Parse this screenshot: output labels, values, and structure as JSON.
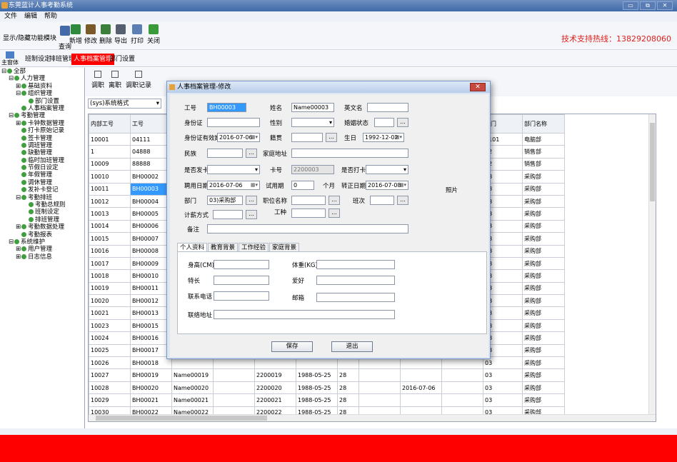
{
  "window": {
    "title": "东莞蓝计人事考勤系统",
    "min_label": "▭",
    "max_label": "⧉",
    "close_label": "✕"
  },
  "menu": [
    "文件",
    "编辑",
    "帮助"
  ],
  "toolbar": {
    "toggle_label": "显示/隐藏功能模块",
    "buttons": [
      {
        "label": "查询",
        "icon": "search-icon",
        "color": "#4469a8"
      },
      {
        "label": "新增",
        "icon": "add-icon",
        "color": "#2f8a3d"
      },
      {
        "label": "修改",
        "icon": "edit-icon",
        "color": "#7a5a2a"
      },
      {
        "label": "删除",
        "icon": "delete-icon",
        "color": "#3b7f3b"
      },
      {
        "label": "导出",
        "icon": "export-icon",
        "color": "#555f6e"
      },
      {
        "label": "打印",
        "icon": "print-icon",
        "color": "#5a7fb5"
      },
      {
        "label": "关闭",
        "icon": "close-icon",
        "color": "#3a9a3a"
      }
    ],
    "hotline": "技术支持热线：13829208060"
  },
  "tabs": {
    "home_label": "主窗体",
    "items": [
      "班制设定",
      "排班管理",
      "人事档案管理",
      "部门设置"
    ],
    "active_index": 2
  },
  "tree": [
    {
      "label": "全部",
      "level": 0,
      "exp": "⊟"
    },
    {
      "label": "人力管理",
      "level": 1,
      "exp": "⊟"
    },
    {
      "label": "基础资料",
      "level": 2,
      "exp": "⊞"
    },
    {
      "label": "组织管理",
      "level": 2,
      "exp": "⊟"
    },
    {
      "label": "部门设置",
      "level": 3,
      "exp": ""
    },
    {
      "label": "人事档案管理",
      "level": 2,
      "exp": ""
    },
    {
      "label": "考勤管理",
      "level": 1,
      "exp": "⊟"
    },
    {
      "label": "卡钟数据管理",
      "level": 2,
      "exp": "⊞"
    },
    {
      "label": "打卡原始记录",
      "level": 2,
      "exp": ""
    },
    {
      "label": "签卡管理",
      "level": 2,
      "exp": ""
    },
    {
      "label": "调班管理",
      "level": 2,
      "exp": ""
    },
    {
      "label": "缺勤管理",
      "level": 2,
      "exp": ""
    },
    {
      "label": "临时加班管理",
      "level": 2,
      "exp": ""
    },
    {
      "label": "节假日设定",
      "level": 2,
      "exp": ""
    },
    {
      "label": "年假管理",
      "level": 2,
      "exp": ""
    },
    {
      "label": "调休管理",
      "level": 2,
      "exp": ""
    },
    {
      "label": "发补卡登记",
      "level": 2,
      "exp": ""
    },
    {
      "label": "考勤排班",
      "level": 2,
      "exp": "⊟"
    },
    {
      "label": "考勤总规则",
      "level": 3,
      "exp": ""
    },
    {
      "label": "班制设定",
      "level": 3,
      "exp": ""
    },
    {
      "label": "排班管理",
      "level": 3,
      "exp": ""
    },
    {
      "label": "考勤数据处理",
      "level": 2,
      "exp": "⊞"
    },
    {
      "label": "考勤报表",
      "level": 2,
      "exp": ""
    },
    {
      "label": "系统维护",
      "level": 1,
      "exp": "⊟"
    },
    {
      "label": "用户管理",
      "level": 2,
      "exp": "⊞"
    },
    {
      "label": "日志信息",
      "level": 2,
      "exp": "⊞"
    }
  ],
  "subtools": [
    {
      "label": "调职"
    },
    {
      "label": "离职"
    },
    {
      "label": "调职记录"
    }
  ],
  "format_combo": "(sys)系统格式",
  "grid": {
    "headers": [
      "内部工号",
      "工号",
      "姓名",
      "",
      "卡号",
      "生日",
      "",
      "",
      "身份证有效期结束日期",
      "籍贯",
      "部门",
      "部门名称"
    ],
    "rows": [
      [
        "10001",
        "04111",
        "",
        "",
        "",
        "",
        "",
        "",
        "2028-08-16",
        "湖南",
        "0101",
        "电脑部"
      ],
      [
        "1",
        "04888",
        "",
        "",
        "",
        "",
        "",
        "",
        "2016-05-02",
        "",
        "02",
        "销售部"
      ],
      [
        "10009",
        "88888",
        "",
        "",
        "",
        "",
        "",
        "",
        "2016-06-25",
        "",
        "02",
        "销售部"
      ],
      [
        "10010",
        "BH00002",
        "",
        "",
        "",
        "",
        "",
        "",
        "2016-07-06",
        "",
        "03",
        "采购部"
      ],
      [
        "10011",
        "BH00003",
        "",
        "",
        "",
        "",
        "",
        "",
        "2016-07-06",
        "",
        "03",
        "采购部"
      ],
      [
        "10012",
        "BH00004",
        "",
        "",
        "",
        "",
        "",
        "",
        "2016-07-06",
        "",
        "03",
        "采购部"
      ],
      [
        "10013",
        "BH00005",
        "",
        "",
        "",
        "",
        "",
        "",
        "2016-07-06",
        "",
        "03",
        "采购部"
      ],
      [
        "10014",
        "BH00006",
        "",
        "",
        "",
        "",
        "",
        "",
        "2016-07-06",
        "",
        "03",
        "采购部"
      ],
      [
        "10015",
        "BH00007",
        "",
        "",
        "",
        "",
        "",
        "",
        "2016-07-06",
        "",
        "03",
        "采购部"
      ],
      [
        "10016",
        "BH00008",
        "",
        "",
        "",
        "",
        "",
        "",
        "2016-07-06",
        "",
        "03",
        "采购部"
      ],
      [
        "10017",
        "BH00009",
        "",
        "",
        "",
        "",
        "",
        "",
        "2016-07-06",
        "",
        "03",
        "采购部"
      ],
      [
        "10018",
        "BH00010",
        "",
        "",
        "",
        "",
        "",
        "",
        "2016-07-06",
        "",
        "03",
        "采购部"
      ],
      [
        "10019",
        "BH00011",
        "",
        "",
        "",
        "",
        "",
        "",
        "2016-07-06",
        "",
        "03",
        "采购部"
      ],
      [
        "10020",
        "BH00012",
        "",
        "",
        "",
        "",
        "",
        "",
        "",
        "",
        "03",
        "采购部"
      ],
      [
        "10021",
        "BH00013",
        "",
        "",
        "",
        "",
        "",
        "",
        "",
        "",
        "03",
        "采购部"
      ],
      [
        "10023",
        "BH00015",
        "",
        "",
        "",
        "",
        "",
        "",
        "",
        "",
        "03",
        "采购部"
      ],
      [
        "10024",
        "BH00016",
        "",
        "",
        "",
        "",
        "",
        "",
        "",
        "",
        "03",
        "采购部"
      ],
      [
        "10025",
        "BH00017",
        "",
        "",
        "",
        "",
        "",
        "",
        "",
        "",
        "03",
        "采购部"
      ],
      [
        "10026",
        "BH00018",
        "",
        "",
        "",
        "",
        "",
        "",
        "",
        "",
        "03",
        "采购部"
      ],
      [
        "10027",
        "BH00019",
        "Name00019",
        "",
        "2200019",
        "1988-05-25",
        "28",
        "",
        "",
        "",
        "03",
        "采购部"
      ],
      [
        "10028",
        "BH00020",
        "Name00020",
        "",
        "2200020",
        "1988-05-25",
        "28",
        "",
        "2016-07-06",
        "",
        "03",
        "采购部"
      ],
      [
        "10029",
        "BH00021",
        "Name00021",
        "",
        "2200021",
        "1988-05-25",
        "28",
        "",
        "",
        "",
        "03",
        "采购部"
      ],
      [
        "10030",
        "BH00022",
        "Name00022",
        "",
        "2200022",
        "1988-05-25",
        "28",
        "",
        "",
        "",
        "03",
        "采购部"
      ],
      [
        "10031",
        "BH00023",
        "Name00023",
        "",
        "2200023",
        "1988-05-25",
        "28",
        "",
        "",
        "",
        "03",
        "采购部"
      ]
    ],
    "selected_row": 4
  },
  "dialog": {
    "title": "人事档案管理-修改",
    "close_label": "✕",
    "labels": {
      "gonghao": "工号",
      "name": "姓名",
      "ename": "英文名",
      "idcard": "身份证",
      "gender": "性别",
      "marital": "婚姻状态",
      "idvalid": "身份证有效期",
      "native": "籍贯",
      "birthday": "生日",
      "nation": "民族",
      "address": "家庭地址",
      "isissue": "是否发卡",
      "cardno": "卡号",
      "isclock": "是否打卡",
      "photo": "照片",
      "hiredate": "聘用日期",
      "trial": "试用期",
      "month": "个月",
      "regular": "转正日期",
      "dept": "部门",
      "position": "职位名称",
      "shift": "班次",
      "salary": "计薪方式",
      "worktype": "工种",
      "remark": "备注"
    },
    "values": {
      "gonghao": "BH00003",
      "name": "Name00003",
      "idvalid": "2016-07-06",
      "birthday": "1992-12-02",
      "cardno": "2200003",
      "hiredate": "2016-07-06",
      "trial": "0",
      "regular": "2016-07-08",
      "dept": "03)采购部"
    },
    "inner_tabs": [
      "个人资料",
      "教育背景",
      "工作经验",
      "家庭背景"
    ],
    "inner_labels": {
      "height": "身高(CM)",
      "weight": "体重(KG)",
      "skill": "特长",
      "hobby": "爱好",
      "phone": "联系电话",
      "email": "邮箱",
      "contact_addr": "联络地址"
    },
    "save_label": "保存",
    "exit_label": "退出",
    "dots": "..."
  }
}
